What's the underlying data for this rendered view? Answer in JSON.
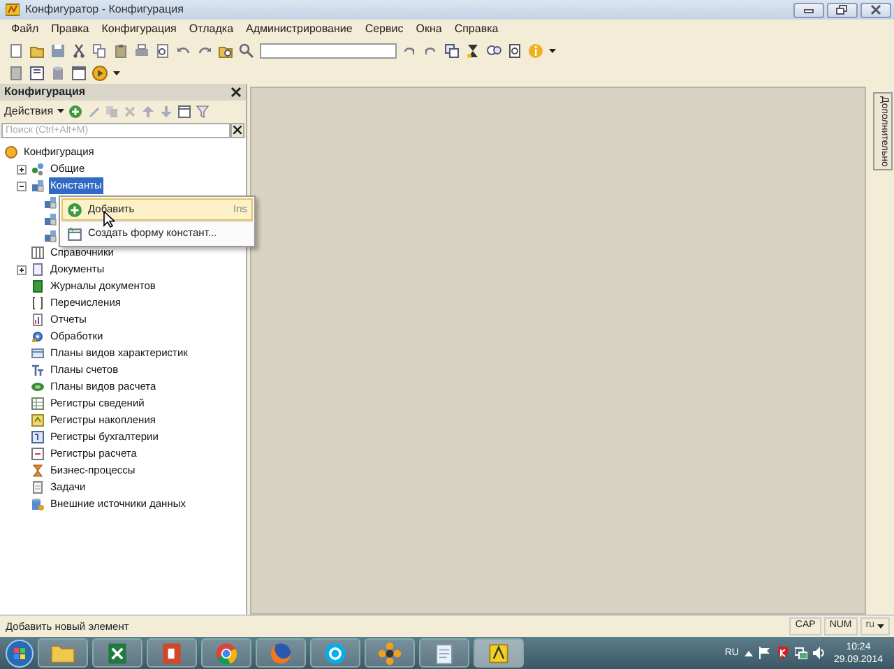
{
  "window": {
    "title": "Конфигуратор - Конфигурация"
  },
  "menu": [
    "Файл",
    "Правка",
    "Конфигурация",
    "Отладка",
    "Администрирование",
    "Сервис",
    "Окна",
    "Справка"
  ],
  "panel": {
    "title": "Конфигурация",
    "actions_label": "Действия"
  },
  "search": {
    "placeholder": "Поиск (Ctrl+Alt+M)"
  },
  "tree": [
    {
      "label": "Конфигурация",
      "selected": false,
      "children": [
        {
          "label": "Общие",
          "selected": false,
          "expanded": false
        },
        {
          "label": "Константы",
          "selected": true,
          "expanded": true,
          "children": [
            {
              "selected": false
            },
            {
              "selected": false
            },
            {
              "selected": false
            }
          ]
        },
        {
          "label": "Справочники",
          "selected": false
        },
        {
          "label": "Документы",
          "selected": false,
          "expanded": false
        },
        {
          "label": "Журналы документов",
          "selected": false
        },
        {
          "label": "Перечисления",
          "selected": false
        },
        {
          "label": "Отчеты",
          "selected": false
        },
        {
          "label": "Обработки",
          "selected": false
        },
        {
          "label": "Планы видов характеристик",
          "selected": false
        },
        {
          "label": "Планы счетов",
          "selected": false
        },
        {
          "label": "Планы видов расчета",
          "selected": false
        },
        {
          "label": "Регистры сведений",
          "selected": false
        },
        {
          "label": "Регистры накопления",
          "selected": false
        },
        {
          "label": "Регистры бухгалтерии",
          "selected": false
        },
        {
          "label": "Регистры расчета",
          "selected": false
        },
        {
          "label": "Бизнес-процессы",
          "selected": false
        },
        {
          "label": "Задачи",
          "selected": false
        },
        {
          "label": "Внешние источники данных",
          "selected": false
        }
      ]
    }
  ],
  "context_menu": [
    {
      "label": "Добавить",
      "shortcut": "Ins",
      "selected": true
    },
    {
      "label": "Создать форму констант...",
      "selected": false
    }
  ],
  "side_tab": "Дополнительно",
  "status_bar": {
    "message": "Добавить новый элемент",
    "indicators": [
      "CAP",
      "NUM"
    ],
    "language": "ru"
  },
  "taskbar": {
    "apps": [
      {
        "selected": false
      },
      {
        "selected": false
      },
      {
        "selected": false
      },
      {
        "selected": false
      },
      {
        "selected": false
      },
      {
        "selected": false
      },
      {
        "selected": false
      },
      {
        "selected": false
      },
      {
        "selected": true
      }
    ],
    "language": "RU",
    "time": "10:24",
    "date": "29.09.2014"
  }
}
